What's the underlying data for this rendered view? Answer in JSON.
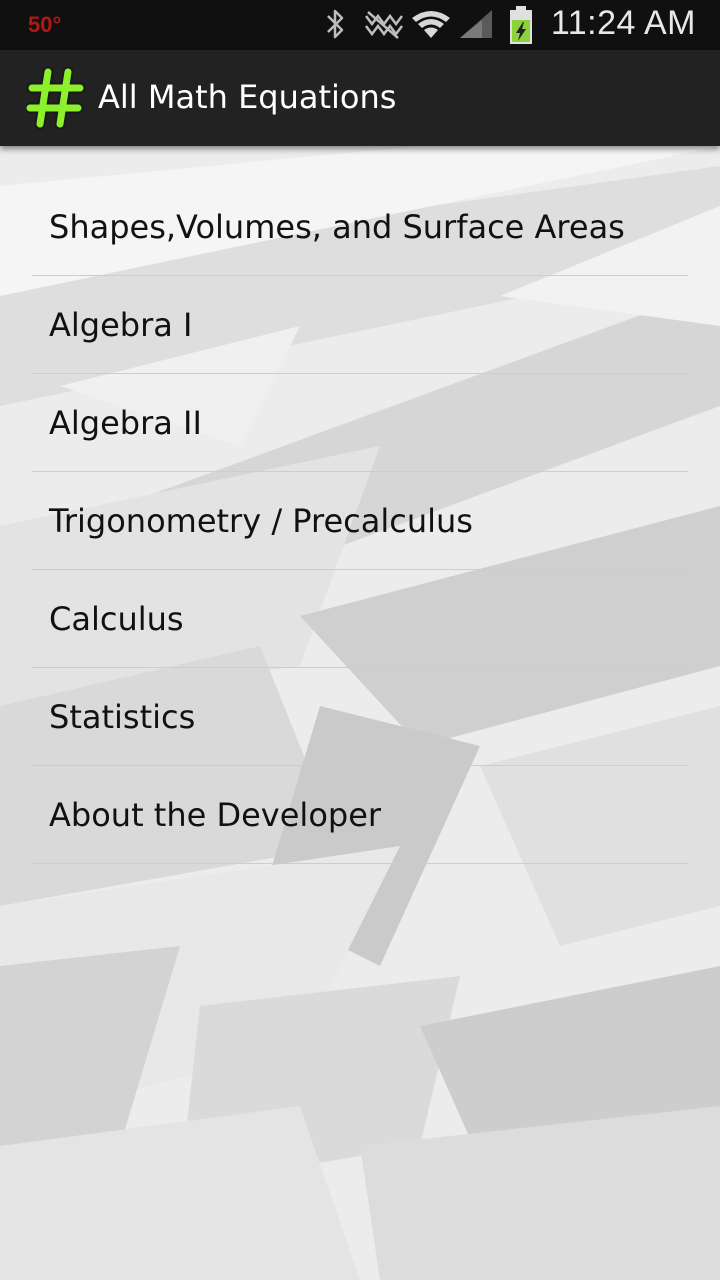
{
  "status_bar": {
    "temperature": "50°",
    "time": "11:24 AM",
    "icons": [
      "bluetooth-icon",
      "nfc-off-icon",
      "wifi-icon",
      "signal-icon",
      "battery-charging-icon"
    ]
  },
  "action_bar": {
    "title": "All Math Equations",
    "icon": "hash-icon",
    "accent_color": "#8cf02a"
  },
  "menu": {
    "items": [
      {
        "label": "Shapes,Volumes, and Surface Areas"
      },
      {
        "label": "Algebra I"
      },
      {
        "label": "Algebra II"
      },
      {
        "label": "Trigonometry / Precalculus"
      },
      {
        "label": "Calculus"
      },
      {
        "label": "Statistics"
      },
      {
        "label": "About the Developer"
      }
    ]
  }
}
